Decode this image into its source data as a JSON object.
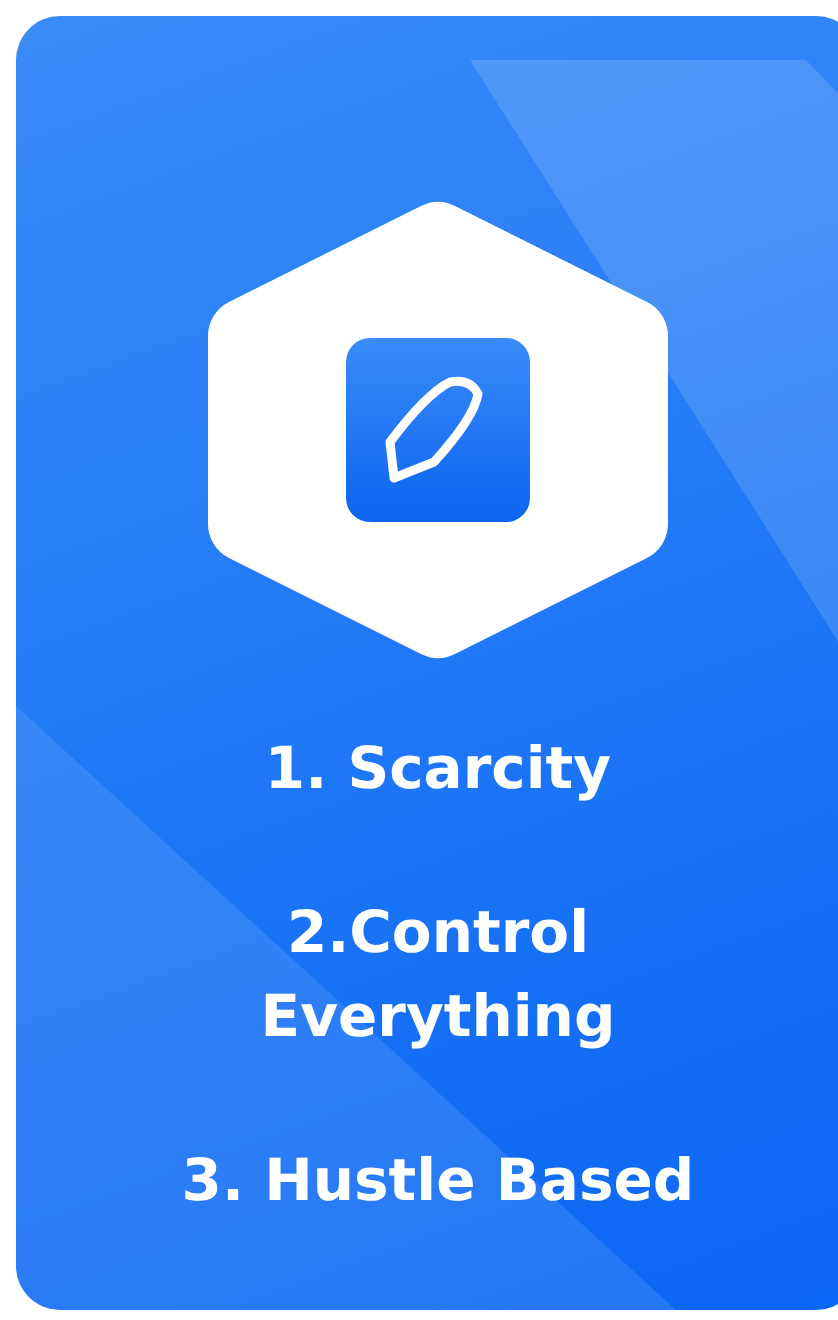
{
  "card": {
    "items": [
      {
        "text": "1. Scarcity"
      },
      {
        "text": "2.Control\nEverything"
      },
      {
        "text": "3. Hustle Based"
      }
    ]
  }
}
